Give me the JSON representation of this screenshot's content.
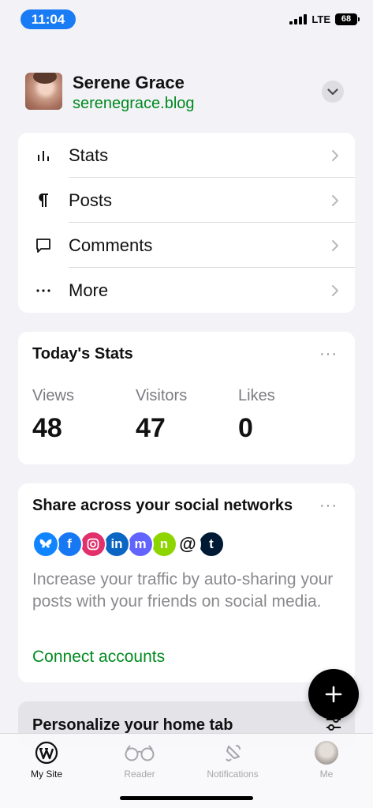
{
  "status_bar": {
    "time": "11:04",
    "network": "LTE",
    "battery": "68"
  },
  "site": {
    "name": "Serene Grace",
    "url": "serenegrace.blog"
  },
  "menu": [
    {
      "label": "Stats",
      "icon": "bar-chart-icon"
    },
    {
      "label": "Posts",
      "icon": "pilcrow-icon"
    },
    {
      "label": "Comments",
      "icon": "comment-icon"
    },
    {
      "label": "More",
      "icon": "ellipsis-icon"
    }
  ],
  "stats_card": {
    "title": "Today's Stats",
    "more": "···",
    "items": [
      {
        "label": "Views",
        "value": "48"
      },
      {
        "label": "Visitors",
        "value": "47"
      },
      {
        "label": "Likes",
        "value": "0"
      }
    ]
  },
  "share_card": {
    "title": "Share across your social networks",
    "more": "···",
    "networks": [
      {
        "name": "bluesky-icon",
        "color": "#1185fe"
      },
      {
        "name": "facebook-icon",
        "color": "#1877f2",
        "glyph": "f"
      },
      {
        "name": "instagram-icon",
        "color": "#e1306c"
      },
      {
        "name": "linkedin-icon",
        "color": "#0a66c2",
        "glyph": "in"
      },
      {
        "name": "mastodon-icon",
        "color": "#6364ff",
        "glyph": "m"
      },
      {
        "name": "nextdoor-icon",
        "color": "#8ed500",
        "glyph": "n"
      },
      {
        "name": "threads-icon",
        "color": "#ffffff",
        "glyph": "@"
      },
      {
        "name": "tumblr-icon",
        "color": "#001935",
        "glyph": "t"
      }
    ],
    "description": "Increase your traffic by auto-sharing your posts with your friends on social media.",
    "connect_label": "Connect accounts"
  },
  "personalize": {
    "title": "Personalize your home tab"
  },
  "tabs": [
    {
      "label": "My Site",
      "active": true
    },
    {
      "label": "Reader",
      "active": false
    },
    {
      "label": "Notifications",
      "active": false
    },
    {
      "label": "Me",
      "active": false
    }
  ],
  "colors": {
    "accent_green": "#008a20",
    "status_blue": "#1a7cf5"
  }
}
